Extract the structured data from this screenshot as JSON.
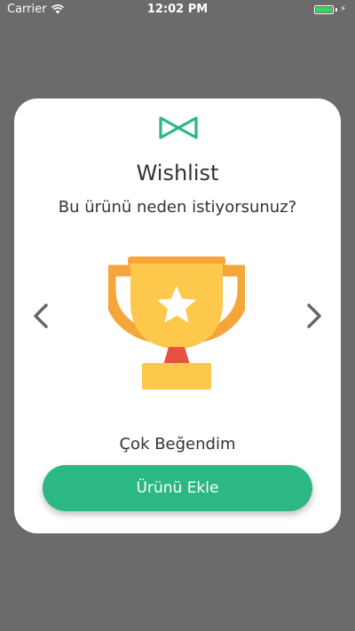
{
  "status_bar": {
    "carrier": "Carrier",
    "time": "12:02 PM",
    "wifi_icon": "wifi-icon",
    "battery_icon": "battery-charging-icon"
  },
  "dialog": {
    "logo_icon": "bowtie-logo-icon",
    "title": "Wishlist",
    "question": "Bu ürünü neden istiyorsunuz?",
    "image_icon": "trophy-icon",
    "selected_reason": "Çok Beğendim",
    "prev_icon": "chevron-left-icon",
    "next_icon": "chevron-right-icon",
    "add_button_label": "Ürünü Ekle"
  },
  "colors": {
    "overlay": "#6b6b6b",
    "card": "#ffffff",
    "accent": "#2bb883",
    "text": "#333333",
    "trophy_gold": "#fdc84c",
    "trophy_orange": "#f4a63a",
    "trophy_red": "#e8513f",
    "battery_green": "#38d55b"
  }
}
